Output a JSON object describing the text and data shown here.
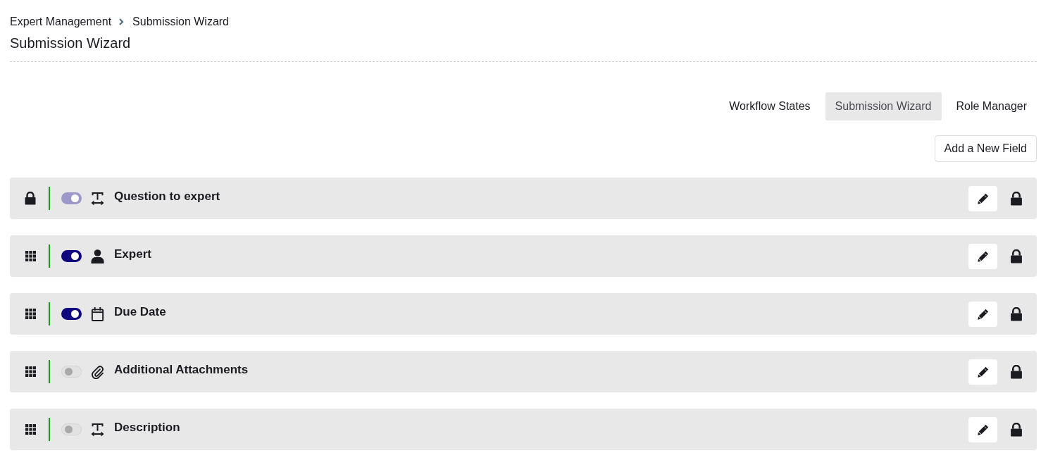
{
  "breadcrumb": [
    "Expert Management",
    "Submission Wizard"
  ],
  "title": "Submission Wizard",
  "tabs": [
    {
      "label": "Workflow States",
      "selected": false
    },
    {
      "label": "Submission Wizard",
      "selected": true
    },
    {
      "label": "Role Manager",
      "selected": false
    }
  ],
  "add_button": "Add a New Field",
  "fields": [
    {
      "label": "Question to expert",
      "kind": "text",
      "locked": true,
      "on": true,
      "disabled": true
    },
    {
      "label": "Expert",
      "kind": "person",
      "locked": false,
      "on": true,
      "disabled": false
    },
    {
      "label": "Due Date",
      "kind": "date",
      "locked": false,
      "on": true,
      "disabled": false
    },
    {
      "label": "Additional Attachments",
      "kind": "attachment",
      "locked": false,
      "on": false,
      "disabled": false
    },
    {
      "label": "Description",
      "kind": "text",
      "locked": false,
      "on": false,
      "disabled": false
    }
  ]
}
